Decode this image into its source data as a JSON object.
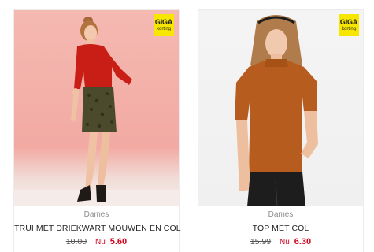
{
  "colors": {
    "badge_bg": "#f7e600",
    "price_accent": "#d0021b",
    "category_text": "#8a8a8a"
  },
  "products": [
    {
      "badge": {
        "top": "GIGA",
        "bottom": "korting"
      },
      "category": "Dames",
      "title": "TRUI MET DRIEKWART MOUWEN EN COL",
      "old_price": "10.00",
      "now_label": "Nu",
      "new_price": "5.60"
    },
    {
      "badge": {
        "top": "GIGA",
        "bottom": "korting"
      },
      "category": "Dames",
      "title": "TOP MET COL",
      "old_price": "15.99",
      "now_label": "Nu",
      "new_price": "6.30"
    }
  ]
}
